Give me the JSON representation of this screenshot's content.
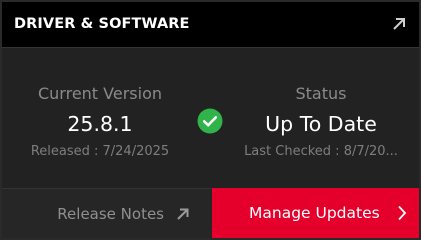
{
  "header": {
    "title": "DRIVER & SOFTWARE",
    "expand_icon": "arrow-up-right-icon"
  },
  "current_version": {
    "label": "Current Version",
    "value": "25.8.1",
    "released": "Released : 7/24/2025"
  },
  "status": {
    "icon": "check-circle-icon",
    "label": "Status",
    "value": "Up To Date",
    "last_checked": "Last Checked : 8/7/20..."
  },
  "footer": {
    "release_notes_label": "Release Notes",
    "release_notes_icon": "arrow-up-right-icon",
    "manage_updates_label": "Manage Updates",
    "manage_updates_icon": "chevron-right-icon"
  },
  "colors": {
    "accent": "#e4002b",
    "success": "#2fb34a",
    "header_bg": "#000000",
    "panel_bg": "#222222"
  }
}
